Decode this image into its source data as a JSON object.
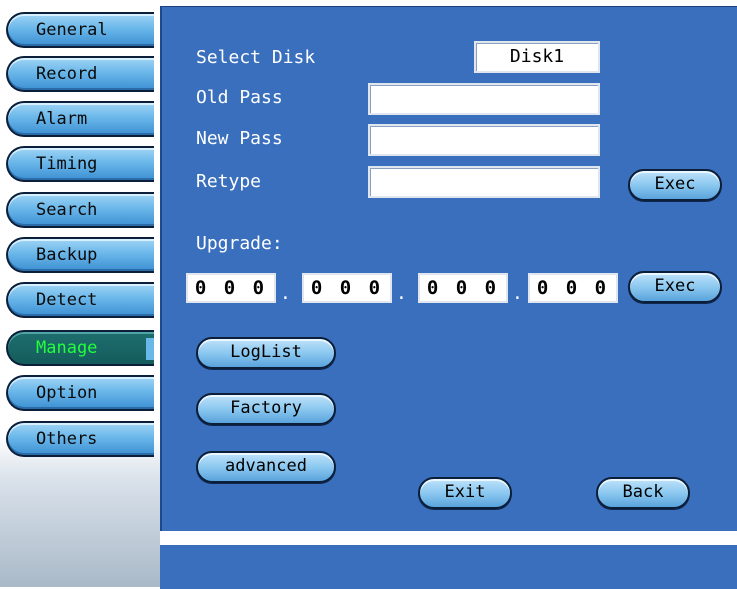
{
  "sidebar": {
    "tabs": [
      {
        "label": "General"
      },
      {
        "label": "Record"
      },
      {
        "label": "Alarm"
      },
      {
        "label": "Timing"
      },
      {
        "label": "Search"
      },
      {
        "label": "Backup"
      },
      {
        "label": "Detect"
      },
      {
        "label": "Manage",
        "active": true
      },
      {
        "label": "Option"
      },
      {
        "label": "Others"
      }
    ]
  },
  "manage": {
    "select_disk_label": "Select Disk",
    "select_disk_value": "Disk1",
    "old_pass_label": "Old Pass",
    "old_pass_value": "",
    "new_pass_label": "New Pass",
    "new_pass_value": "",
    "retype_label": "Retype",
    "retype_value": "",
    "exec_password_label": "Exec",
    "upgrade_label": "Upgrade:",
    "upgrade_ip": [
      "0 0 0",
      "0 0 0",
      "0 0 0",
      "0 0 0"
    ],
    "ip_separator": ".",
    "exec_upgrade_label": "Exec",
    "loglist_label": "LogList",
    "factory_label": "Factory",
    "advanced_label": "advanced",
    "exit_label": "Exit",
    "back_label": "Back"
  },
  "colors": {
    "panel_bg": "#3a6fbe",
    "active_tab_text": "#20ff3a"
  }
}
